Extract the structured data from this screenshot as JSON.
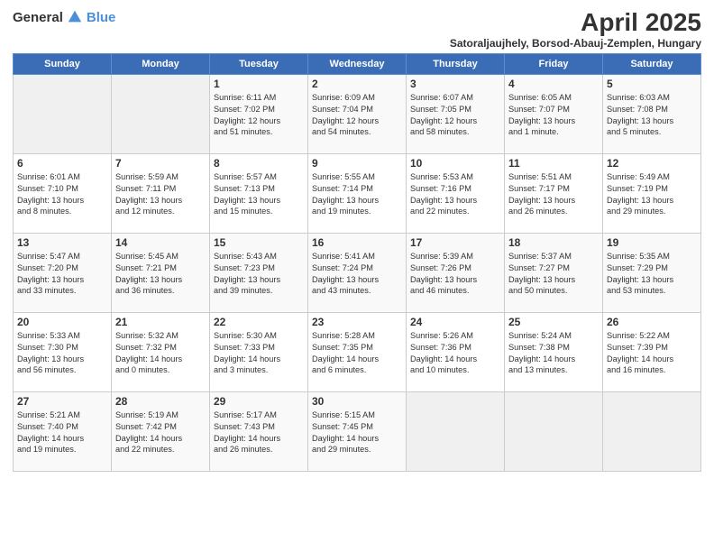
{
  "logo": {
    "general": "General",
    "blue": "Blue"
  },
  "header": {
    "title": "April 2025",
    "subtitle": "Satoraljaujhely, Borsod-Abauj-Zemplen, Hungary"
  },
  "weekdays": [
    "Sunday",
    "Monday",
    "Tuesday",
    "Wednesday",
    "Thursday",
    "Friday",
    "Saturday"
  ],
  "weeks": [
    [
      {
        "day": "",
        "info": ""
      },
      {
        "day": "",
        "info": ""
      },
      {
        "day": "1",
        "info": "Sunrise: 6:11 AM\nSunset: 7:02 PM\nDaylight: 12 hours\nand 51 minutes."
      },
      {
        "day": "2",
        "info": "Sunrise: 6:09 AM\nSunset: 7:04 PM\nDaylight: 12 hours\nand 54 minutes."
      },
      {
        "day": "3",
        "info": "Sunrise: 6:07 AM\nSunset: 7:05 PM\nDaylight: 12 hours\nand 58 minutes."
      },
      {
        "day": "4",
        "info": "Sunrise: 6:05 AM\nSunset: 7:07 PM\nDaylight: 13 hours\nand 1 minute."
      },
      {
        "day": "5",
        "info": "Sunrise: 6:03 AM\nSunset: 7:08 PM\nDaylight: 13 hours\nand 5 minutes."
      }
    ],
    [
      {
        "day": "6",
        "info": "Sunrise: 6:01 AM\nSunset: 7:10 PM\nDaylight: 13 hours\nand 8 minutes."
      },
      {
        "day": "7",
        "info": "Sunrise: 5:59 AM\nSunset: 7:11 PM\nDaylight: 13 hours\nand 12 minutes."
      },
      {
        "day": "8",
        "info": "Sunrise: 5:57 AM\nSunset: 7:13 PM\nDaylight: 13 hours\nand 15 minutes."
      },
      {
        "day": "9",
        "info": "Sunrise: 5:55 AM\nSunset: 7:14 PM\nDaylight: 13 hours\nand 19 minutes."
      },
      {
        "day": "10",
        "info": "Sunrise: 5:53 AM\nSunset: 7:16 PM\nDaylight: 13 hours\nand 22 minutes."
      },
      {
        "day": "11",
        "info": "Sunrise: 5:51 AM\nSunset: 7:17 PM\nDaylight: 13 hours\nand 26 minutes."
      },
      {
        "day": "12",
        "info": "Sunrise: 5:49 AM\nSunset: 7:19 PM\nDaylight: 13 hours\nand 29 minutes."
      }
    ],
    [
      {
        "day": "13",
        "info": "Sunrise: 5:47 AM\nSunset: 7:20 PM\nDaylight: 13 hours\nand 33 minutes."
      },
      {
        "day": "14",
        "info": "Sunrise: 5:45 AM\nSunset: 7:21 PM\nDaylight: 13 hours\nand 36 minutes."
      },
      {
        "day": "15",
        "info": "Sunrise: 5:43 AM\nSunset: 7:23 PM\nDaylight: 13 hours\nand 39 minutes."
      },
      {
        "day": "16",
        "info": "Sunrise: 5:41 AM\nSunset: 7:24 PM\nDaylight: 13 hours\nand 43 minutes."
      },
      {
        "day": "17",
        "info": "Sunrise: 5:39 AM\nSunset: 7:26 PM\nDaylight: 13 hours\nand 46 minutes."
      },
      {
        "day": "18",
        "info": "Sunrise: 5:37 AM\nSunset: 7:27 PM\nDaylight: 13 hours\nand 50 minutes."
      },
      {
        "day": "19",
        "info": "Sunrise: 5:35 AM\nSunset: 7:29 PM\nDaylight: 13 hours\nand 53 minutes."
      }
    ],
    [
      {
        "day": "20",
        "info": "Sunrise: 5:33 AM\nSunset: 7:30 PM\nDaylight: 13 hours\nand 56 minutes."
      },
      {
        "day": "21",
        "info": "Sunrise: 5:32 AM\nSunset: 7:32 PM\nDaylight: 14 hours\nand 0 minutes."
      },
      {
        "day": "22",
        "info": "Sunrise: 5:30 AM\nSunset: 7:33 PM\nDaylight: 14 hours\nand 3 minutes."
      },
      {
        "day": "23",
        "info": "Sunrise: 5:28 AM\nSunset: 7:35 PM\nDaylight: 14 hours\nand 6 minutes."
      },
      {
        "day": "24",
        "info": "Sunrise: 5:26 AM\nSunset: 7:36 PM\nDaylight: 14 hours\nand 10 minutes."
      },
      {
        "day": "25",
        "info": "Sunrise: 5:24 AM\nSunset: 7:38 PM\nDaylight: 14 hours\nand 13 minutes."
      },
      {
        "day": "26",
        "info": "Sunrise: 5:22 AM\nSunset: 7:39 PM\nDaylight: 14 hours\nand 16 minutes."
      }
    ],
    [
      {
        "day": "27",
        "info": "Sunrise: 5:21 AM\nSunset: 7:40 PM\nDaylight: 14 hours\nand 19 minutes."
      },
      {
        "day": "28",
        "info": "Sunrise: 5:19 AM\nSunset: 7:42 PM\nDaylight: 14 hours\nand 22 minutes."
      },
      {
        "day": "29",
        "info": "Sunrise: 5:17 AM\nSunset: 7:43 PM\nDaylight: 14 hours\nand 26 minutes."
      },
      {
        "day": "30",
        "info": "Sunrise: 5:15 AM\nSunset: 7:45 PM\nDaylight: 14 hours\nand 29 minutes."
      },
      {
        "day": "",
        "info": ""
      },
      {
        "day": "",
        "info": ""
      },
      {
        "day": "",
        "info": ""
      }
    ]
  ]
}
